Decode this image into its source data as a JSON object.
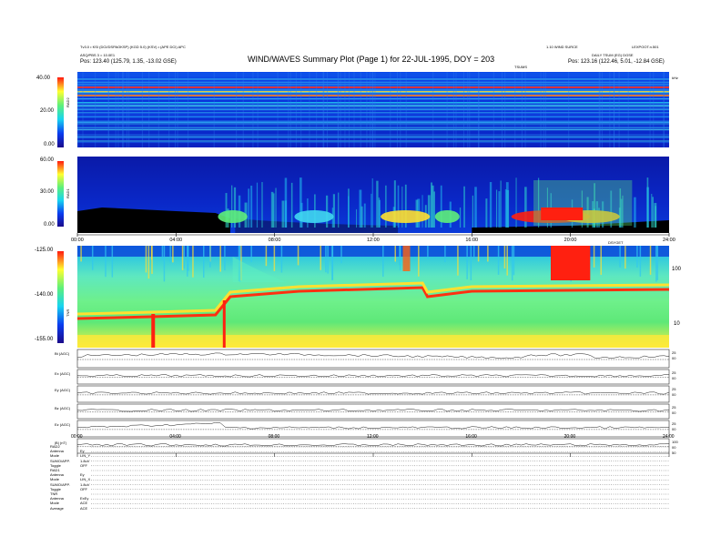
{
  "header": {
    "title": "WIND/WAVES Summary Plot (Page 1) for 22-JUL-1995, DOY = 203",
    "top_left_1": "Tv3.0 • KSI (DCI/DSPAOKSP) (KGD 5.0) (KSV) • (APE DCI) APC",
    "top_left_2": "ASQ/PBS 3 = 10.0E1",
    "pos_left_label": "Pos:",
    "pos_left_value": "123.40 (125.79, 1.35, -13.02 GSE)",
    "top_right_1": "1.10 WIND SURCE",
    "top_right_2": "LEXPOOT.n.501",
    "top_right_3": "DAILY TSUM (EG) DGSE",
    "pos_right_label": "Pos:",
    "pos_right_value": "123.16 (122.46, 5.01, -12.84 GSE)",
    "center_right_label": "TSUMS"
  },
  "panels": {
    "rad2": {
      "ylabel": "RAD2",
      "yticks": [
        "40.00",
        "20.00",
        "0.00"
      ],
      "corner_label": "kHz"
    },
    "rad1": {
      "ylabel": "RAD1",
      "yticks": [
        "60.00",
        "30.00",
        "0.00"
      ]
    },
    "tnr": {
      "ylabel": "TNR",
      "yticks": [
        "-125.00",
        "-140.00",
        "-155.00"
      ],
      "right_ticks": [
        "100",
        "10"
      ],
      "corner_label": "DSYGET"
    },
    "time_ticks": [
      "00:00",
      "04:00",
      "08:00",
      "12:00",
      "16:00",
      "20:00",
      "24:00"
    ],
    "line_plots": [
      {
        "label": "Bt (AGC)",
        "right": [
          "25",
          "00"
        ]
      },
      {
        "label": "Ex (AGC)",
        "right": [
          "25",
          "00"
        ]
      },
      {
        "label": "Ey (AGC)",
        "right": [
          "25",
          "00"
        ]
      },
      {
        "label": "Bz (AGC)",
        "right": [
          "25",
          "00"
        ]
      },
      {
        "label": "Ez (AGC)",
        "right": [
          "25",
          "00"
        ]
      },
      {
        "label": "|B| (nT)",
        "right": [
          "100",
          "00",
          "50"
        ]
      }
    ]
  },
  "footer": {
    "rows": [
      {
        "k": "RAD2",
        "v": ""
      },
      {
        "k": "Antenna",
        "v": "Ey"
      },
      {
        "k": "Mode",
        "v": "LIN_Y"
      },
      {
        "k": "SUMO/APP.",
        "v": "1.8uV"
      },
      {
        "k": "Toggle",
        "v": "OFF"
      },
      {
        "k": "RAD1",
        "v": ""
      },
      {
        "k": "Antenna",
        "v": "Ey"
      },
      {
        "k": "Mode",
        "v": "LIN_X"
      },
      {
        "k": "SUMO/APP.",
        "v": "1.8uV"
      },
      {
        "k": "Toggle",
        "v": "OFF"
      },
      {
        "k": "TNR",
        "v": ""
      },
      {
        "k": "Antenna",
        "v": "ExEy"
      },
      {
        "k": "Mode",
        "v": "ACE"
      },
      {
        "k": "Average",
        "v": "ACE"
      }
    ]
  },
  "colors": {
    "background": "#ffffff",
    "deep_blue": "#0a1fc8",
    "cyan": "#18d4f0",
    "green": "#5ef07a",
    "yellow": "#ffff30",
    "red": "#ff1a10"
  },
  "chart_data": [
    {
      "type": "heatmap",
      "panel": "RAD2",
      "x_range_hours": [
        0,
        24
      ],
      "y_range": [
        0,
        40
      ],
      "colorbar_range": [
        0,
        40
      ],
      "description_bands_y": [
        38,
        33,
        28,
        24,
        20
      ]
    },
    {
      "type": "heatmap",
      "panel": "RAD1",
      "x_range_hours": [
        0,
        24
      ],
      "y_range": [
        0,
        60
      ],
      "bursts": [
        {
          "t": 6.0,
          "level": 2
        },
        {
          "t": 9.5,
          "level": 2
        },
        {
          "t": 13.0,
          "level": 3
        },
        {
          "t": 15.0,
          "level": 2
        },
        {
          "t": 19.5,
          "level": 4
        },
        {
          "t": 20.5,
          "level": 3
        }
      ]
    },
    {
      "type": "heatmap",
      "panel": "TNR",
      "x_range_hours": [
        0,
        24
      ],
      "y_range": [
        -155,
        -125
      ]
    },
    {
      "type": "line",
      "panel": "Bt (AGC)",
      "x": [
        0,
        2,
        4,
        6,
        8,
        10,
        12,
        14,
        16,
        18,
        20,
        22,
        24
      ],
      "y": [
        0.4,
        0.4,
        0.45,
        0.5,
        0.6,
        0.55,
        0.5,
        0.55,
        0.6,
        0.65,
        0.75,
        0.65,
        0.55
      ]
    }
  ]
}
